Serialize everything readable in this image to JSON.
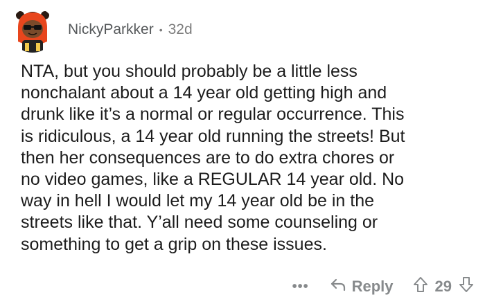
{
  "comment": {
    "username": "NickyParkker",
    "separator": "•",
    "age": "32d",
    "avatar_icon": "snoo-avatar-icon",
    "body": "NTA, but you should probably be a little less\nnonchalant about a 14 year old getting high and\ndrunk like it’s a normal or regular occurrence. This\nis ridiculous, a 14 year old running the streets! But\nthen her consequences are to do extra chores or\nno video games, like a REGULAR 14 year old. No\nway in hell I would let my 14 year old be in the\nstreets like that. Y’all need some counseling or\nsomething to get a grip on these issues.",
    "actions": {
      "more_label": "•••",
      "reply_label": "Reply",
      "score": "29"
    }
  },
  "colors": {
    "meta_text": "#7c7c7c",
    "body_text": "#1c1c1c",
    "action_text": "#878a8c",
    "avatar_hood": "#e8461d",
    "avatar_skin": "#7a4a2a"
  }
}
